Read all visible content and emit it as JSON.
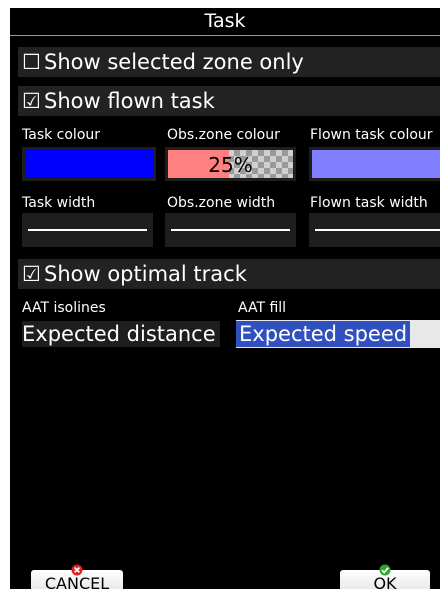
{
  "title": "Task",
  "show_selected_zone_only": {
    "checkbox": "☐",
    "label": "Show selected zone only",
    "checked": false
  },
  "show_flown_task": {
    "checkbox": "☑",
    "label": "Show flown task",
    "checked": true
  },
  "colours": {
    "task_label": "Task colour",
    "obs_label": "Obs.zone colour",
    "flown_label": "Flown task colour",
    "task_colour": "#0000ff",
    "obs_colour": "#ff8080",
    "obs_opacity": "25%",
    "flown_colour": "#8080ff"
  },
  "widths": {
    "task_label": "Task width",
    "obs_label": "Obs.zone width",
    "flown_label": "Flown task width"
  },
  "show_optimal_track": {
    "checkbox": "☑",
    "label": "Show optimal track",
    "checked": true
  },
  "aat": {
    "isolines_label": "AAT isolines",
    "isolines_value": "Expected distance",
    "fill_label": "AAT fill",
    "fill_value": "Expected speed",
    "selection_colour": "#3050c0"
  },
  "buttons": {
    "cancel": "CANCEL",
    "ok": "OK",
    "cancel_icon": "red-x-icon",
    "ok_icon": "green-check-icon"
  }
}
